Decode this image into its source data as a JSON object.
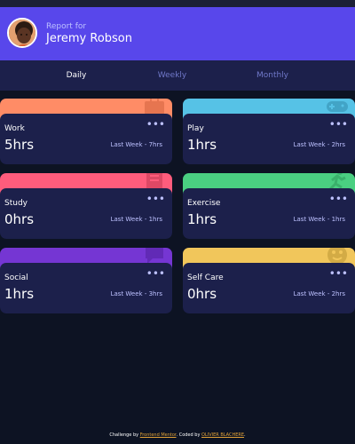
{
  "profile": {
    "report_for": "Report for",
    "name": "Jeremy Robson"
  },
  "tabs": [
    {
      "label": "Daily",
      "active": true
    },
    {
      "label": "Weekly",
      "active": false
    },
    {
      "label": "Monthly",
      "active": false
    }
  ],
  "cards": [
    {
      "title": "Work",
      "hours": "5hrs",
      "previous": "Last Week - 7hrs",
      "color": "#ff8c66",
      "icon": "briefcase-icon"
    },
    {
      "title": "Play",
      "hours": "1hrs",
      "previous": "Last Week - 2hrs",
      "color": "#56c2e6",
      "icon": "gamepad-icon"
    },
    {
      "title": "Study",
      "hours": "0hrs",
      "previous": "Last Week - 1hrs",
      "color": "#ff5c7c",
      "icon": "book-icon"
    },
    {
      "title": "Exercise",
      "hours": "1hrs",
      "previous": "Last Week - 1hrs",
      "color": "#4acf81",
      "icon": "runner-icon"
    },
    {
      "title": "Social",
      "hours": "1hrs",
      "previous": "Last Week - 3hrs",
      "color": "#7536d3",
      "icon": "chat-icon"
    },
    {
      "title": "Self Care",
      "hours": "0hrs",
      "previous": "Last Week - 2hrs",
      "color": "#f1c65b",
      "icon": "self-care-icon"
    }
  ],
  "menu_glyph": "•••",
  "footer": {
    "challenge_by": "Challenge by",
    "challenge_link": "Frontend Mentor",
    "coded_by": ". Coded by",
    "coded_link": "OLIVIER BLACHERE",
    "end": "."
  },
  "colors": {
    "background": "#0d1323",
    "card": "#1c204b",
    "accent": "#5847eb",
    "muted": "#bdc1ff"
  }
}
